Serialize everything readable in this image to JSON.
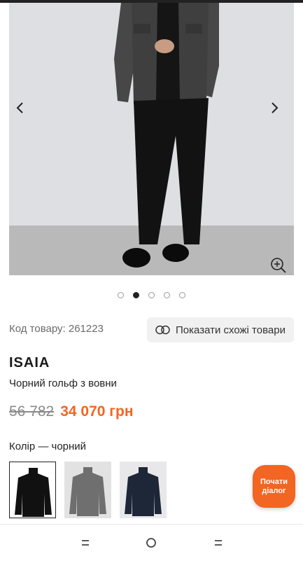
{
  "product": {
    "sku_label": "Код товару: 261223",
    "similar_button": "Показати схожі товари",
    "brand": "ISAIA",
    "name": "Чорний гольф з вовни",
    "price_old": "56 782",
    "price_new": "34 070 грн",
    "color_label": "Колір — чорний"
  },
  "gallery": {
    "dots_count": 5,
    "active_dot": 2,
    "prev_icon": "chevron-left-icon",
    "next_icon": "chevron-right-icon",
    "zoom_icon": "zoom-in-icon"
  },
  "swatches": [
    {
      "color_name": "black",
      "color": "#111111",
      "selected": true
    },
    {
      "color_name": "grey",
      "color": "#6f6f6f",
      "selected": false
    },
    {
      "color_name": "navy",
      "color": "#1e2738",
      "selected": false
    }
  ],
  "chat": {
    "label": "Почати діалог"
  },
  "colors": {
    "accent": "#f26522"
  }
}
